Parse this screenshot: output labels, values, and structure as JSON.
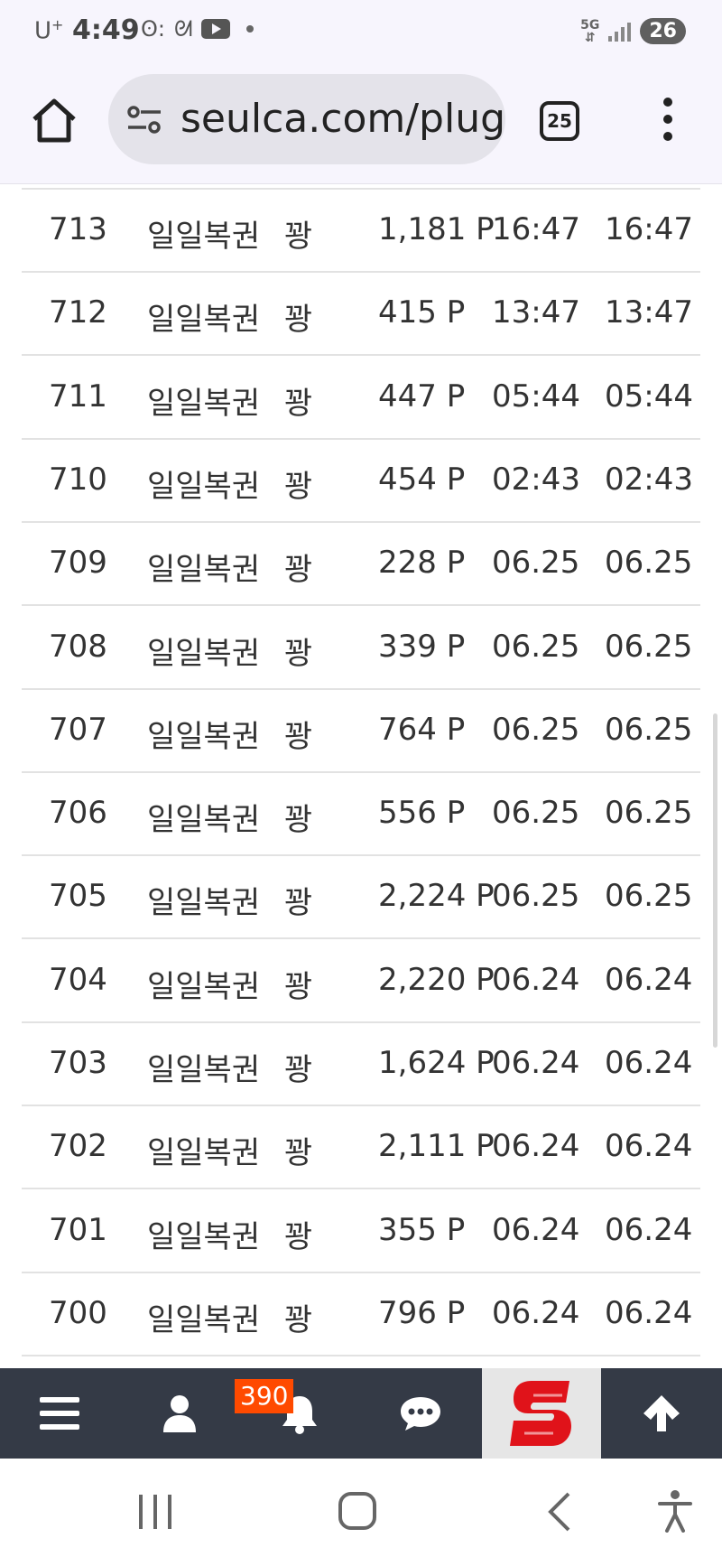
{
  "status_bar": {
    "carrier": "U",
    "carrier_sup": "+",
    "time": "4:49",
    "network": "5G",
    "battery": "26"
  },
  "browser": {
    "url": "seulca.com/plugi",
    "tab_count": "25"
  },
  "table": {
    "rows": [
      {
        "num": "713",
        "title": "일일복권",
        "result": "꽝",
        "points": "1,181 P",
        "date1": "16:47",
        "date2": "16:47"
      },
      {
        "num": "712",
        "title": "일일복권",
        "result": "꽝",
        "points": "415 P",
        "date1": "13:47",
        "date2": "13:47"
      },
      {
        "num": "711",
        "title": "일일복권",
        "result": "꽝",
        "points": "447 P",
        "date1": "05:44",
        "date2": "05:44"
      },
      {
        "num": "710",
        "title": "일일복권",
        "result": "꽝",
        "points": "454 P",
        "date1": "02:43",
        "date2": "02:43"
      },
      {
        "num": "709",
        "title": "일일복권",
        "result": "꽝",
        "points": "228 P",
        "date1": "06.25",
        "date2": "06.25"
      },
      {
        "num": "708",
        "title": "일일복권",
        "result": "꽝",
        "points": "339 P",
        "date1": "06.25",
        "date2": "06.25"
      },
      {
        "num": "707",
        "title": "일일복권",
        "result": "꽝",
        "points": "764 P",
        "date1": "06.25",
        "date2": "06.25"
      },
      {
        "num": "706",
        "title": "일일복권",
        "result": "꽝",
        "points": "556 P",
        "date1": "06.25",
        "date2": "06.25"
      },
      {
        "num": "705",
        "title": "일일복권",
        "result": "꽝",
        "points": "2,224 P",
        "date1": "06.25",
        "date2": "06.25"
      },
      {
        "num": "704",
        "title": "일일복권",
        "result": "꽝",
        "points": "2,220 P",
        "date1": "06.24",
        "date2": "06.24"
      },
      {
        "num": "703",
        "title": "일일복권",
        "result": "꽝",
        "points": "1,624 P",
        "date1": "06.24",
        "date2": "06.24"
      },
      {
        "num": "702",
        "title": "일일복권",
        "result": "꽝",
        "points": "2,111 P",
        "date1": "06.24",
        "date2": "06.24"
      },
      {
        "num": "701",
        "title": "일일복권",
        "result": "꽝",
        "points": "355 P",
        "date1": "06.24",
        "date2": "06.24"
      },
      {
        "num": "700",
        "title": "일일복권",
        "result": "꽝",
        "points": "796 P",
        "date1": "06.24",
        "date2": "06.24"
      }
    ]
  },
  "toolbar": {
    "notification_count": "390",
    "items": [
      "menu-icon",
      "user-icon",
      "bell-icon",
      "chat-icon",
      "site-logo",
      "arrow-up-icon"
    ]
  },
  "colors": {
    "toolbar_bg": "#343a46",
    "badge_bg": "#ff4a00",
    "logo_red": "#e0131a",
    "browser_bg": "#f7f5fd"
  }
}
